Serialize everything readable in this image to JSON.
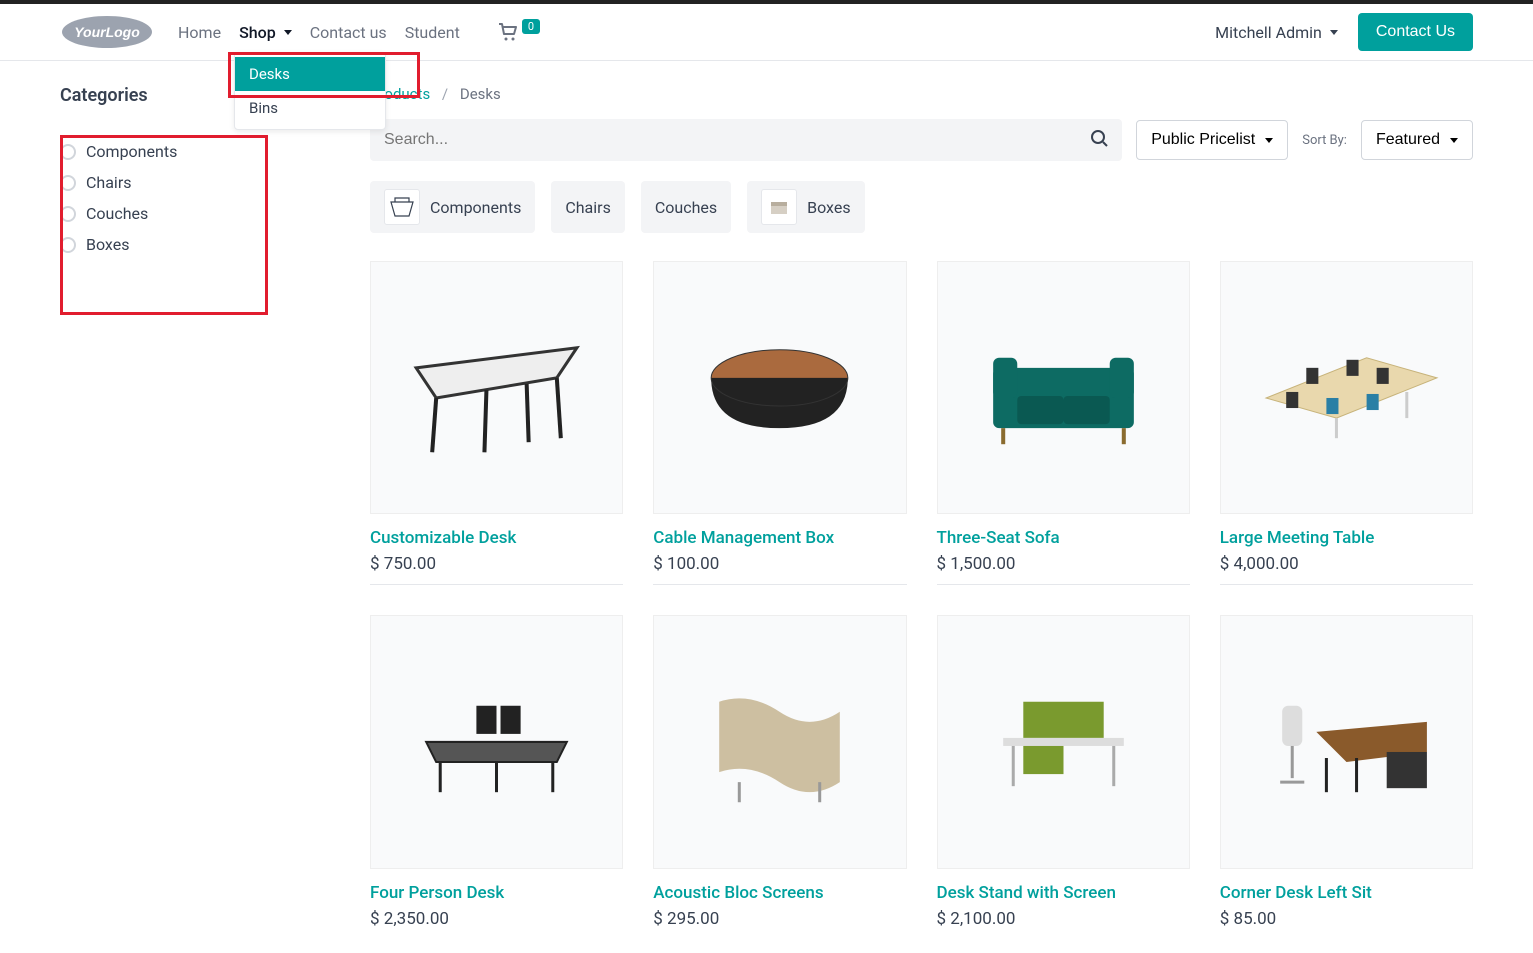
{
  "header": {
    "nav": {
      "home": "Home",
      "shop": "Shop",
      "contact": "Contact us",
      "student": "Student"
    },
    "cart_count": "0",
    "user": "Mitchell Admin",
    "contact_btn": "Contact Us",
    "shop_menu": {
      "desks": "Desks",
      "bins": "Bins"
    }
  },
  "sidebar": {
    "title": "Categories",
    "cats": [
      "Components",
      "Chairs",
      "Couches",
      "Boxes"
    ]
  },
  "breadcrumb": {
    "products": "Products",
    "current": "Desks"
  },
  "controls": {
    "search_placeholder": "Search...",
    "pricelist": "Public Pricelist",
    "sort_label": "Sort By:",
    "sort_value": "Featured"
  },
  "chips": [
    "Components",
    "Chairs",
    "Couches",
    "Boxes"
  ],
  "products": [
    {
      "title": "Customizable Desk",
      "price": "$ 750.00"
    },
    {
      "title": "Cable Management Box",
      "price": "$ 100.00"
    },
    {
      "title": "Three-Seat Sofa",
      "price": "$ 1,500.00"
    },
    {
      "title": "Large Meeting Table",
      "price": "$ 4,000.00"
    },
    {
      "title": "Four Person Desk",
      "price": "$ 2,350.00"
    },
    {
      "title": "Acoustic Bloc Screens",
      "price": "$ 295.00"
    },
    {
      "title": "Desk Stand with Screen",
      "price": "$ 2,100.00"
    },
    {
      "title": "Corner Desk Left Sit",
      "price": "$ 85.00"
    }
  ]
}
